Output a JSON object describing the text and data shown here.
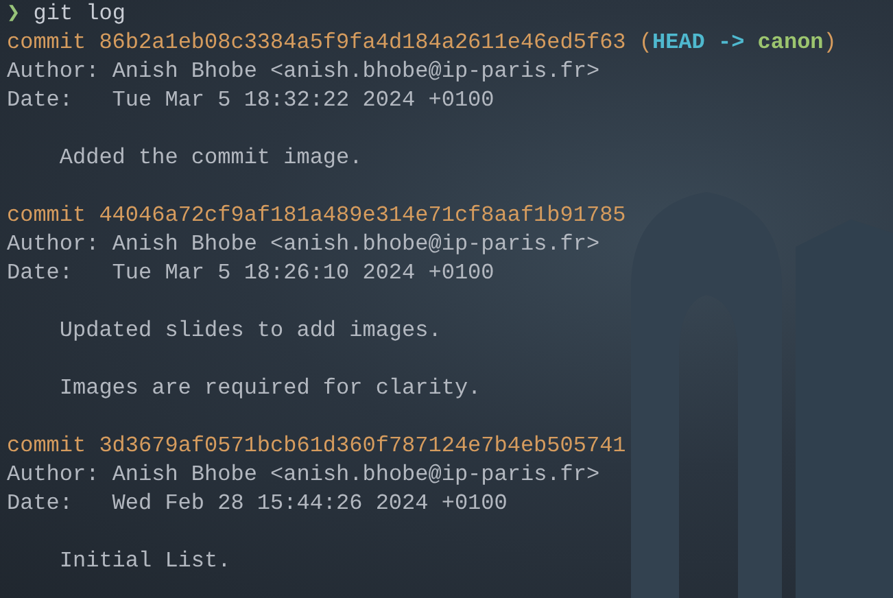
{
  "prompt": {
    "symbol": "❯",
    "command": "git log"
  },
  "commits": [
    {
      "label": "commit",
      "hash": "86b2a1eb08c3384a5f9fa4d184a2611e46ed5f63",
      "refs": {
        "open": "(",
        "close": ")",
        "head": "HEAD",
        "arrow": "->",
        "branch": "canon"
      },
      "author_label": "Author:",
      "author": "Anish Bhobe <anish.bhobe@ip-paris.fr>",
      "date_label": "Date:",
      "date": "Tue Mar 5 18:32:22 2024 +0100",
      "message": [
        "Added the commit image."
      ]
    },
    {
      "label": "commit",
      "hash": "44046a72cf9af181a489e314e71cf8aaf1b91785",
      "author_label": "Author:",
      "author": "Anish Bhobe <anish.bhobe@ip-paris.fr>",
      "date_label": "Date:",
      "date": "Tue Mar 5 18:26:10 2024 +0100",
      "message": [
        "Updated slides to add images.",
        "Images are required for clarity."
      ]
    },
    {
      "label": "commit",
      "hash": "3d3679af0571bcb61d360f787124e7b4eb505741",
      "author_label": "Author:",
      "author": "Anish Bhobe <anish.bhobe@ip-paris.fr>",
      "date_label": "Date:",
      "date": "Wed Feb 28 15:44:26 2024 +0100",
      "message": [
        "Initial List."
      ]
    }
  ]
}
